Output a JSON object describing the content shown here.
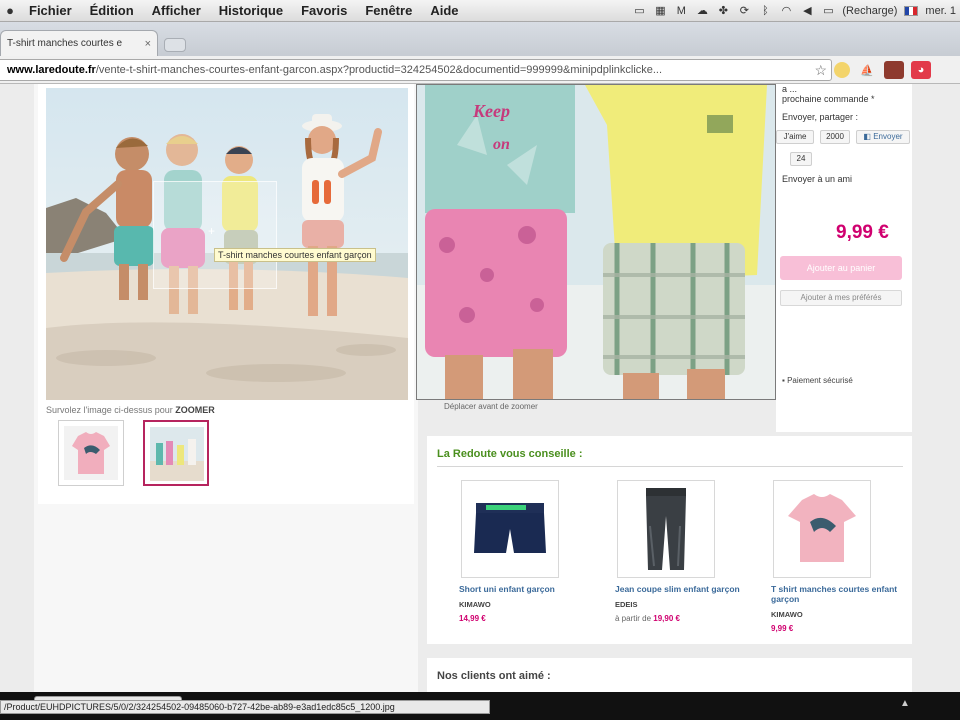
{
  "menubar": {
    "apple": "",
    "items": [
      "Fichier",
      "Édition",
      "Afficher",
      "Historique",
      "Favoris",
      "Fenêtre",
      "Aide"
    ],
    "battery": "(Recharge)",
    "clock": "mer. 1"
  },
  "browser": {
    "tab_title": "T-shirt manches courtes e",
    "tab_close": "×",
    "url_host": "www.laredoute.fr",
    "url_path": "/vente-t-shirt-manches-courtes-enfant-garcon.aspx?productid=324254502&documentid=999999&minipdplinkclicke...",
    "star": "☆"
  },
  "gallery": {
    "zoom_tooltip": "T-shirt manches courtes enfant garçon",
    "hint_prefix": "Survolez l'image ci-dessus pour",
    "hint_strong": "ZOOMER",
    "zoom_caption": "Déplacer avant de zoomer"
  },
  "sidebar": {
    "next_order_line1": "a ...",
    "next_order_line2": "prochaine commande *",
    "share_title": "Envoyer, partager :",
    "like_label": "J'aime",
    "like_count": "2000",
    "send_label": "Envoyer",
    "plus_count": "24",
    "send_friend": "Envoyer à un ami",
    "price": "9,99 €",
    "add_to_cart": "Ajouter au panier",
    "add_to_favorites": "Ajouter à mes préférés",
    "secure_payment": "Paiement sécurisé"
  },
  "recommendations": {
    "title": "La Redoute vous conseille :",
    "products": [
      {
        "name": "Short uni enfant garçon",
        "brand": "KIMAWO",
        "price_prefix": "",
        "price": "14,99 €"
      },
      {
        "name": "Jean coupe slim enfant garçon",
        "brand": "EDEIS",
        "price_prefix": "à partir de",
        "price": "19,90 €"
      },
      {
        "name": "T shirt manches courtes enfant garçon",
        "brand": "KIMAWO",
        "price_prefix": "",
        "price": "9,99 €"
      }
    ]
  },
  "clients": {
    "title": "Nos clients ont aimé :"
  },
  "status": {
    "url": "/Product/EUHDPICTURES/5/0/2/324254502-09485060-b727-42be-ab89-e3ad1edc85c5_1200.jpg"
  },
  "colors": {
    "accent_pink": "#d0006f",
    "reco_green": "#4a8f1e",
    "link_blue": "#3b6a9a"
  }
}
